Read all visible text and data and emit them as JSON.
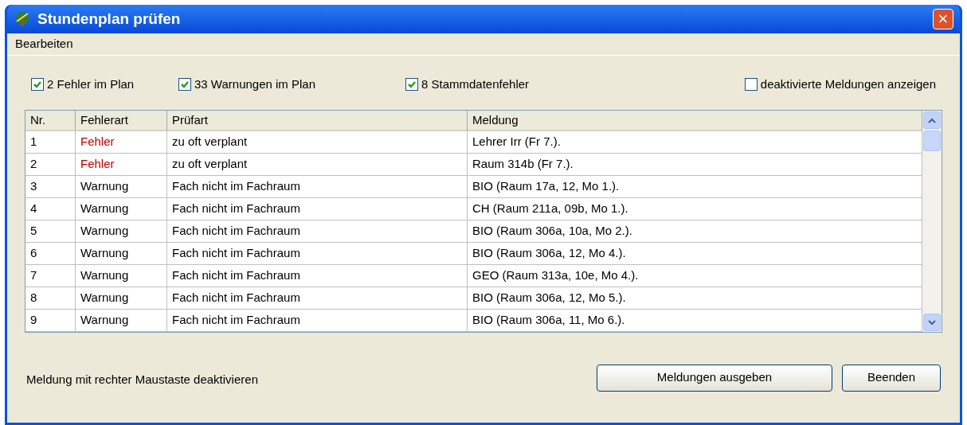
{
  "window": {
    "title": "Stundenplan prüfen",
    "close": "×"
  },
  "menu": [
    "Bearbeiten"
  ],
  "filters": [
    {
      "label": "2 Fehler im Plan",
      "checked": true
    },
    {
      "label": "33 Warnungen im Plan",
      "checked": true
    },
    {
      "label": "8 Stammdatenfehler",
      "checked": true
    },
    {
      "label": "deaktivierte Meldungen anzeigen",
      "checked": false
    }
  ],
  "table": {
    "columns": [
      "Nr.",
      "Fehlerart",
      "Prüfart",
      "Meldung"
    ],
    "rows": [
      {
        "kind": "error",
        "cells": [
          "1",
          "Fehler",
          "zu oft verplant",
          "Lehrer Irr (Fr 7.)."
        ]
      },
      {
        "kind": "error",
        "cells": [
          "2",
          "Fehler",
          "zu oft verplant",
          "Raum 314b (Fr 7.)."
        ]
      },
      {
        "kind": "warning",
        "cells": [
          "3",
          "Warnung",
          "Fach nicht im Fachraum",
          "BIO (Raum 17a, 12, Mo 1.)."
        ]
      },
      {
        "kind": "warning",
        "cells": [
          "4",
          "Warnung",
          "Fach nicht im Fachraum",
          "CH (Raum 211a, 09b, Mo 1.)."
        ]
      },
      {
        "kind": "warning",
        "cells": [
          "5",
          "Warnung",
          "Fach nicht im Fachraum",
          "BIO (Raum 306a, 10a, Mo 2.)."
        ]
      },
      {
        "kind": "warning",
        "cells": [
          "6",
          "Warnung",
          "Fach nicht im Fachraum",
          "BIO (Raum 306a, 12, Mo 4.)."
        ]
      },
      {
        "kind": "warning",
        "cells": [
          "7",
          "Warnung",
          "Fach nicht im Fachraum",
          "GEO (Raum 313a, 10e, Mo 4.)."
        ]
      },
      {
        "kind": "warning",
        "cells": [
          "8",
          "Warnung",
          "Fach nicht im Fachraum",
          "BIO (Raum 306a, 12, Mo 5.)."
        ]
      },
      {
        "kind": "warning",
        "cells": [
          "9",
          "Warnung",
          "Fach nicht im Fachraum",
          "BIO (Raum 306a, 11, Mo 6.)."
        ]
      }
    ]
  },
  "status_text": "Meldung mit rechter Maustaste deaktivieren",
  "buttons": [
    "Meldungen ausgeben",
    "Beenden"
  ]
}
